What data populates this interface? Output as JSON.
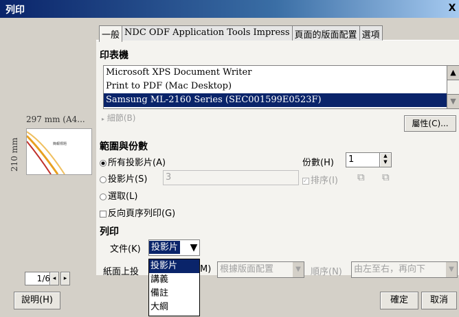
{
  "window": {
    "title": "列印",
    "close_label": "X"
  },
  "tabs": [
    {
      "label": "一般"
    },
    {
      "label": "NDC ODF Application Tools Impress"
    },
    {
      "label": "頁面的版面配置"
    },
    {
      "label": "選項"
    }
  ],
  "printer": {
    "section_title": "印表機",
    "list": [
      "Microsoft XPS Document Writer",
      "Print to PDF (Mac Desktop)",
      "Samsung ML-2160 Series (SEC001599E0523F)"
    ],
    "selected_index": 2,
    "details_label": "細節(B)",
    "properties_label": "屬性(C)..."
  },
  "preview": {
    "size_label": "297 mm (A4...",
    "height_label": "210 mm",
    "slide_title": "簡報標題",
    "page_value": "1",
    "page_total": "/6"
  },
  "range": {
    "section_title": "範圍與份數",
    "all_slides": "所有投影片(A)",
    "slides": "投影片(S)",
    "slides_value": "3",
    "selection": "選取(L)",
    "reverse": "反向頁序列印(G)",
    "copies_label": "份數(H)",
    "copies_value": "1",
    "collate_label": "排序(I)"
  },
  "print": {
    "section_title": "列印",
    "document_label": "文件(K)",
    "document_value": "投影片",
    "options": [
      "投影片",
      "講義",
      "備註",
      "大綱"
    ],
    "pages_label_visible": "紙面上投",
    "pages_label_suffix": "M)",
    "pages_value": "根據版面配置",
    "order_label": "順序(N)",
    "order_value": "由左至右，再向下"
  },
  "buttons": {
    "help": "說明(H)",
    "ok": "確定",
    "cancel": "取消"
  }
}
